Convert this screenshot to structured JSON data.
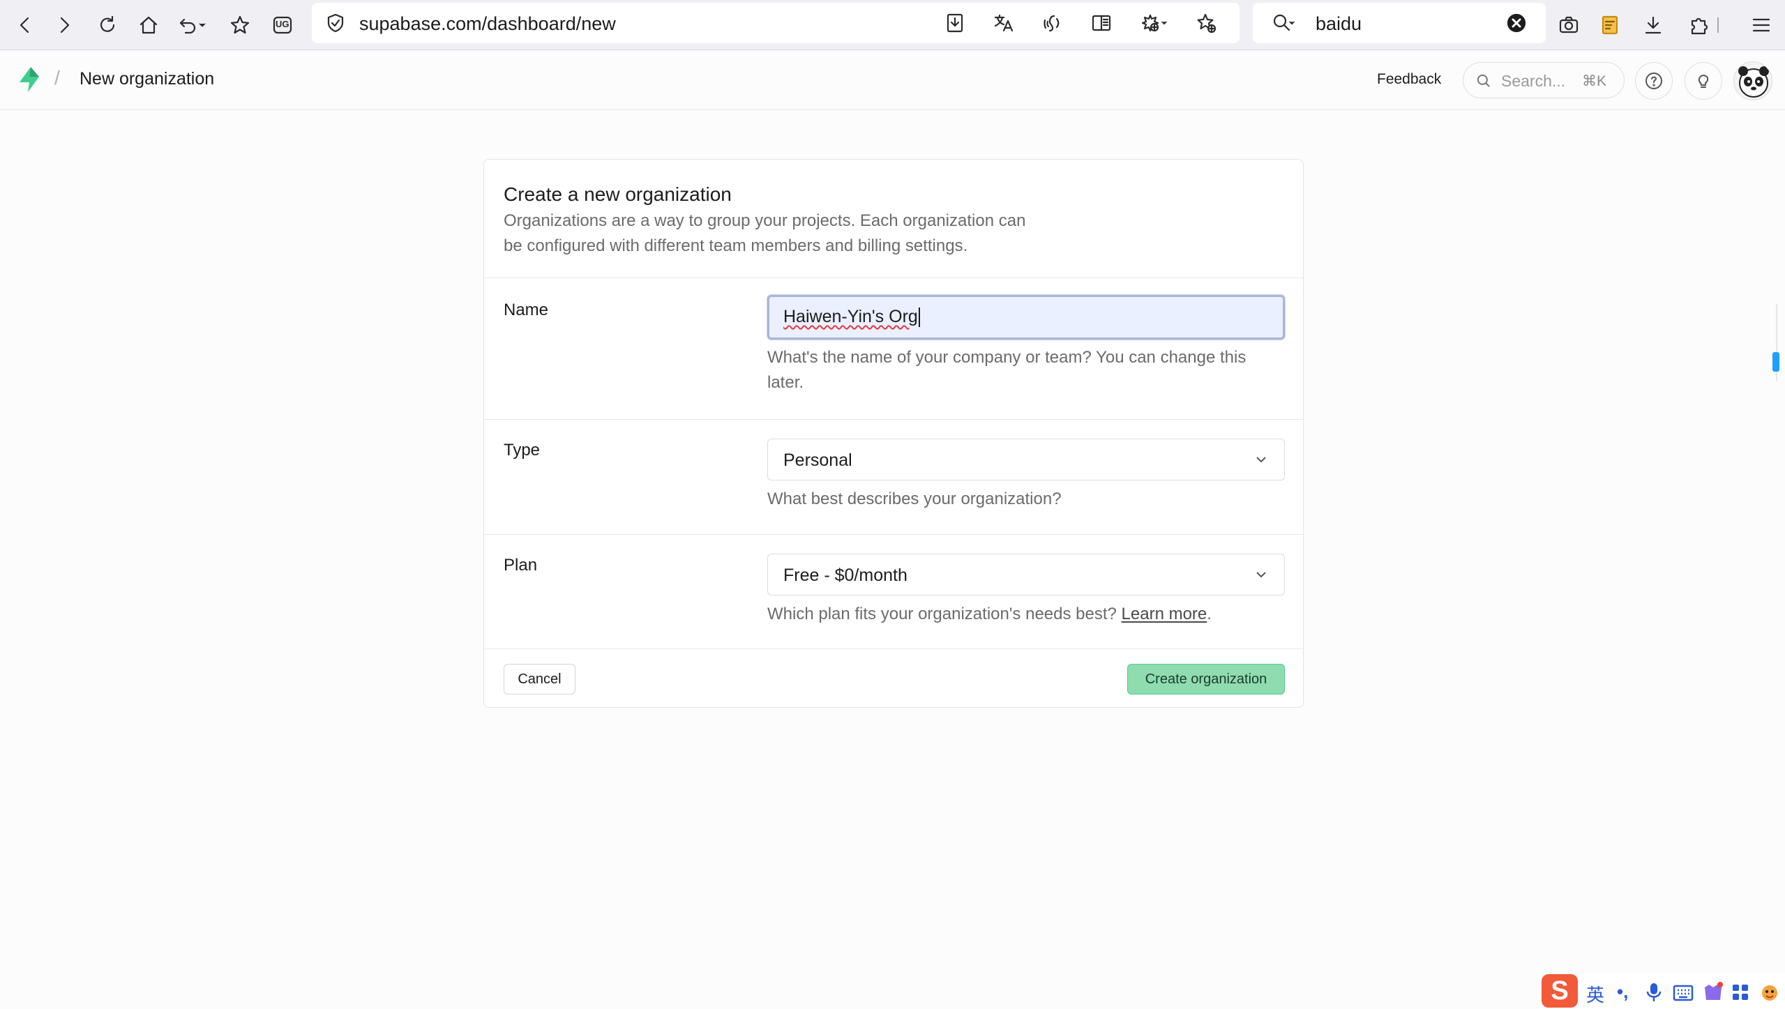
{
  "browser": {
    "url": "supabase.com/dashboard/new",
    "search_value": "baidu",
    "ug_label": "UG"
  },
  "header": {
    "breadcrumb_separator": "/",
    "page_name": "New organization",
    "feedback_label": "Feedback",
    "search_placeholder": "Search...",
    "search_shortcut": "⌘K"
  },
  "form": {
    "title": "Create a new organization",
    "description": "Organizations are a way to group your projects. Each organization can be configured with different team members and billing settings.",
    "name": {
      "label": "Name",
      "value": "Haiwen-Yin's Org",
      "help": "What's the name of your company or team? You can change this later."
    },
    "type": {
      "label": "Type",
      "value": "Personal",
      "help": "What best describes your organization?"
    },
    "plan": {
      "label": "Plan",
      "value": "Free - $0/month",
      "help_prefix": "Which plan fits your organization's needs best?",
      "help_link": "Learn more",
      "help_suffix": "."
    },
    "cancel_label": "Cancel",
    "submit_label": "Create organization"
  },
  "ime": {
    "logo": "S",
    "lang": "英",
    "punct": "•,"
  },
  "colors": {
    "brand_green": "#3ecf8e",
    "submit_bg": "#8fdcb0",
    "focus_bg": "#eaf0ff",
    "scroll_indicator": "#1ea0ff"
  }
}
